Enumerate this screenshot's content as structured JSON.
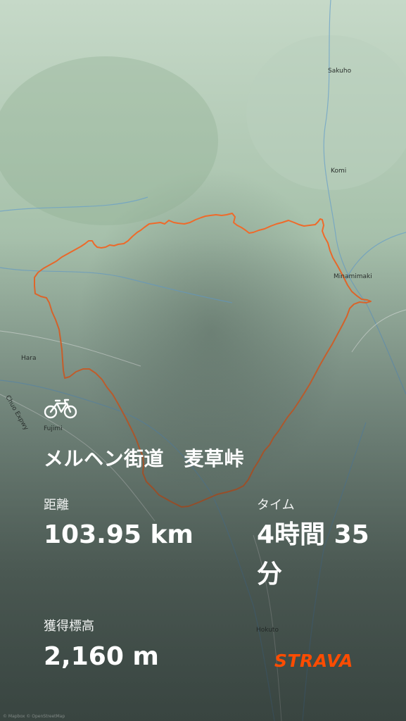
{
  "map": {
    "places": [
      {
        "name": "Sakuho"
      },
      {
        "name": "Komi"
      },
      {
        "name": "Minamimaki"
      },
      {
        "name": "Hara"
      },
      {
        "name": "Chuo Expwy"
      },
      {
        "name": "Fujimi"
      },
      {
        "name": "Hokuto"
      }
    ],
    "route_color": "#ef6a2a",
    "attribution": "© Mapbox © OpenStreetMap"
  },
  "activity": {
    "type_icon": "bicycle-icon",
    "title": "メルヘン街道　麦草峠"
  },
  "stats": {
    "distance_label": "距離",
    "distance_value": "103.95 km",
    "time_label": "タイム",
    "time_value_line1": "4時間 35",
    "time_value_line2": "分",
    "elevation_label": "獲得標高",
    "elevation_value": "2,160 m"
  },
  "brand": {
    "name": "STRAVA",
    "color": "#fc4c02"
  }
}
